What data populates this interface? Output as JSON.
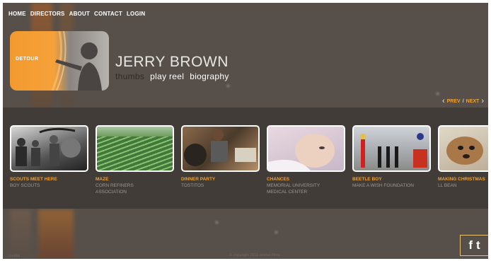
{
  "nav": {
    "items": [
      "HOME",
      "DIRECTORS",
      "ABOUT",
      "CONTACT",
      "LOGIN"
    ]
  },
  "logo": {
    "text": "DETOUR"
  },
  "director": {
    "name": "JERRY BROWN",
    "links": [
      "thumbs",
      "play reel",
      "biography"
    ]
  },
  "pager": {
    "prev": "PREV",
    "separator": "/",
    "next": "NEXT"
  },
  "thumbnails": [
    {
      "title": "SCOUTS MEET HERE",
      "sub1": "BOY SCOUTS",
      "sub2": "",
      "sub3": ""
    },
    {
      "title": "MAZE",
      "sub1": "CORN REFINERS",
      "sub2": "ASSOCIATION",
      "sub3": ""
    },
    {
      "title": "DINNER PARTY",
      "sub1": "TOSTITOS",
      "sub2": "",
      "sub3": ""
    },
    {
      "title": "CHANCES",
      "sub1": "MEMORIAL UNIVERSITY",
      "sub2": "MEDICAL CENTER",
      "sub3": ""
    },
    {
      "title": "BEETLE BOY",
      "sub1": "MAKE A WISH FOUNDATION",
      "sub2": "",
      "sub3": ""
    },
    {
      "title": "MAKING CHRISTMAS",
      "sub1": "LL BEAN",
      "sub2": "",
      "sub3": ""
    }
  ],
  "social": {
    "facebook": "f",
    "twitter": "t"
  },
  "footer": {
    "credits": "credits",
    "copyright": "© copyright 2011 detour films"
  },
  "colors": {
    "accent": "#f0a030",
    "background": "#57504a",
    "band": "#413c38"
  }
}
